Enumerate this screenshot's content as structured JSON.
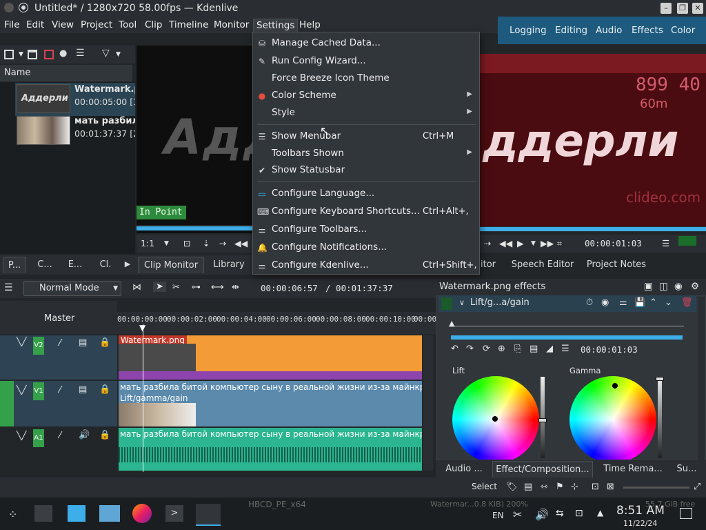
{
  "window": {
    "title": "Untitled* / 1280x720 58.00fps — Kdenlive"
  },
  "menubar": {
    "items": [
      "File",
      "Edit",
      "View",
      "Project",
      "Tool",
      "Clip",
      "Timeline",
      "Monitor",
      "Settings",
      "Help"
    ],
    "active": "Settings"
  },
  "layouts": [
    "Logging",
    "Editing",
    "Audio",
    "Effects",
    "Color"
  ],
  "settings_menu": {
    "items": [
      {
        "label": "Manage Cached Data...",
        "shortcut": "",
        "submenu": false,
        "icon": "database-icon"
      },
      {
        "label": "Run Config Wizard...",
        "shortcut": "",
        "submenu": false,
        "icon": "wand-icon"
      },
      {
        "label": "Force Breeze Icon Theme",
        "shortcut": "",
        "submenu": false,
        "icon": ""
      },
      {
        "label": "Color Scheme",
        "shortcut": "",
        "submenu": true,
        "icon": "palette-icon"
      },
      {
        "label": "Style",
        "shortcut": "",
        "submenu": true,
        "icon": ""
      },
      {
        "label": "Show Menubar",
        "shortcut": "Ctrl+M",
        "submenu": false,
        "icon": "menubar-icon"
      },
      {
        "label": "Toolbars Shown",
        "shortcut": "",
        "submenu": true,
        "icon": ""
      },
      {
        "label": "Show Statusbar",
        "shortcut": "",
        "submenu": false,
        "icon": "check-icon"
      },
      {
        "label": "Configure Language...",
        "shortcut": "",
        "submenu": false,
        "icon": "language-icon"
      },
      {
        "label": "Configure Keyboard Shortcuts...",
        "shortcut": "Ctrl+Alt+,",
        "submenu": false,
        "icon": "keyboard-icon"
      },
      {
        "label": "Configure Toolbars...",
        "shortcut": "",
        "submenu": false,
        "icon": "toolbar-icon"
      },
      {
        "label": "Configure Notifications...",
        "shortcut": "",
        "submenu": false,
        "icon": "bell-icon"
      },
      {
        "label": "Configure Kdenlive...",
        "shortcut": "Ctrl+Shift+,",
        "submenu": false,
        "icon": "settings-icon"
      }
    ]
  },
  "bin": {
    "header": "Name",
    "clips": [
      {
        "name": "Watermark.p",
        "duration": "00:00:05:00 [1",
        "thumb_text": "Аддерли"
      },
      {
        "name": "мать разбил",
        "duration": "00:01:37:37 [2"
      }
    ],
    "tabs": [
      "P...",
      "C...",
      "E...",
      "Cl."
    ]
  },
  "clip_monitor": {
    "overlay_text": "Адд",
    "in_point_label": "In Point",
    "zoom": "1:1",
    "tabs": [
      "Clip Monitor",
      "Library"
    ]
  },
  "project_monitor": {
    "overlay_text": "ддерли",
    "num_text": "899 40",
    "sub_text": "60m",
    "watermark_text": "clideo.com",
    "timecode": "00:00:01:03",
    "tabs": [
      "itor",
      "Speech Editor",
      "Project Notes"
    ]
  },
  "timeline": {
    "mode": "Normal Mode",
    "position": "00:00:06:57",
    "duration": "/ 00:01:37:37",
    "master_label": "Master",
    "ruler": [
      "00:00:00:00",
      "00:00:02:00",
      "00:00:04:00",
      "00:00:06:00",
      "00:00:08:00",
      "00:00:10:00",
      "00:00"
    ],
    "tracks": [
      {
        "tag": "V2",
        "clip_name": "Watermark.png",
        "clip_color": "#f39c37"
      },
      {
        "tag": "V1",
        "clip_name": "мать разбила битой компьютер сыну в реальной жизни из-за майнкрафт анти-гр",
        "effect": "Lift/gamma/gain",
        "clip_color": "#5b8aad"
      },
      {
        "tag": "A1",
        "clip_name": "мать разбила битой компьютер сыну в реальной жизни из-за майнкрафт анти-гр",
        "clip_color": "#2bb590"
      }
    ]
  },
  "effects": {
    "header": "Watermark.png effects",
    "effect_name": "Lift/g...a/gain",
    "timecode": "00:00:01:03",
    "wheels": [
      "Lift",
      "Gamma"
    ],
    "tabs": [
      "Audio ...",
      "Effect/Composition...",
      "Time Rema...",
      "Su..."
    ]
  },
  "statusbar": {
    "select_label": "Select",
    "bg_text_left": "HBCD_PE_x64",
    "bg_text_mid": "Watermar...0.8 KiB)  200%",
    "bg_text_right": "55.7 GiB free"
  },
  "taskbar": {
    "lang": "EN",
    "time": "8:51 AM",
    "date": "11/22/24"
  },
  "colors": {
    "accent": "#3daee9",
    "layout_bar": "#1e5a7d",
    "v2_clip": "#f39c37",
    "v1_clip": "#5b8aad",
    "a1_clip": "#2bb590"
  }
}
